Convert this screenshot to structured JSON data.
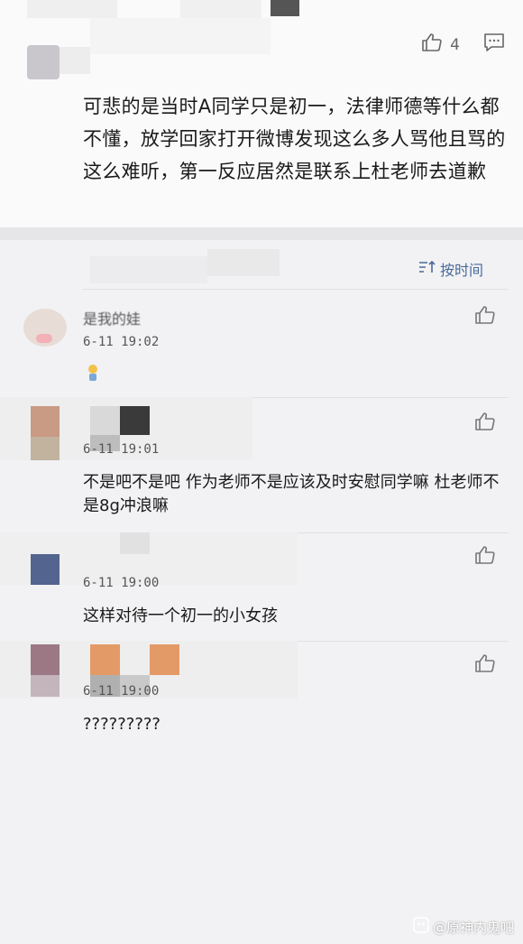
{
  "top_comment": {
    "like_count": "4",
    "text": "可悲的是当时A同学只是初一，法律师德等什么都不懂，放学回家打开微博发现这么多人骂他且骂的这么难听，第一反应居然是联系上杜老师去道歉"
  },
  "sort": {
    "label": "按时间"
  },
  "replies": [
    {
      "username": "是我的娃",
      "time": "6-11 19:02",
      "text": ""
    },
    {
      "time": "6-11 19:01",
      "text": "不是吧不是吧 作为老师不是应该及时安慰同学嘛 杜老师不是8g冲浪嘛"
    },
    {
      "time": "6-11 19:00",
      "text": "这样对待一个初一的小女孩"
    },
    {
      "time": "6-11 19:00",
      "text": "?????????"
    }
  ],
  "watermark": {
    "text": "@原神内鬼吧"
  },
  "colors": {
    "accent": "#4a6a9a",
    "bg": "#f2f2f4",
    "card": "#fafafa"
  }
}
